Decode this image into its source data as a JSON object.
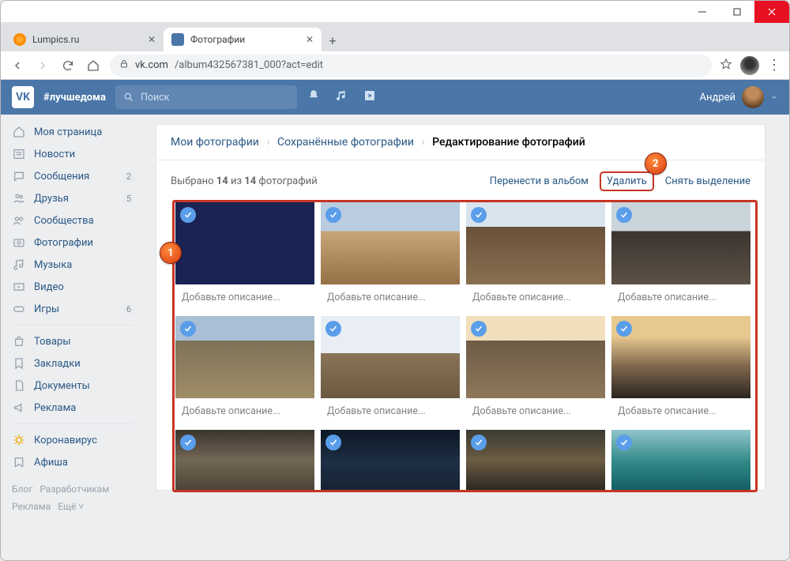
{
  "window": {
    "tabs": [
      {
        "title": "Lumpics.ru",
        "active": false
      },
      {
        "title": "Фотографии",
        "active": true
      }
    ]
  },
  "browser": {
    "url_host": "vk.com",
    "url_path": "/album432567381_000?act=edit"
  },
  "vk": {
    "logo_text": "VK",
    "hashtag": "#лучшедома",
    "search_placeholder": "Поиск",
    "user_name": "Андрей"
  },
  "sidebar": {
    "items": [
      {
        "icon": "home",
        "label": "Моя страница"
      },
      {
        "icon": "news",
        "label": "Новости"
      },
      {
        "icon": "messages",
        "label": "Сообщения",
        "badge": "2"
      },
      {
        "icon": "friends",
        "label": "Друзья",
        "badge": "5"
      },
      {
        "icon": "groups",
        "label": "Сообщества"
      },
      {
        "icon": "photos",
        "label": "Фотографии"
      },
      {
        "icon": "music",
        "label": "Музыка"
      },
      {
        "icon": "video",
        "label": "Видео"
      },
      {
        "icon": "games",
        "label": "Игры",
        "badge": "6"
      }
    ],
    "items2": [
      {
        "icon": "market",
        "label": "Товары"
      },
      {
        "icon": "bookmark",
        "label": "Закладки"
      },
      {
        "icon": "docs",
        "label": "Документы"
      },
      {
        "icon": "ads",
        "label": "Реклама"
      }
    ],
    "items3": [
      {
        "icon": "covid",
        "label": "Коронавирус"
      },
      {
        "icon": "afisha",
        "label": "Афиша"
      }
    ],
    "footer": {
      "l1a": "Блог",
      "l1b": "Разработчикам",
      "l2a": "Реклама",
      "l2b": "Ещё ˅"
    }
  },
  "breadcrumbs": {
    "root": "Мои фотографии",
    "album": "Сохранённые фотографии",
    "current": "Редактирование фотографий"
  },
  "selection_bar": {
    "text_pre": "Выбрано ",
    "sel": "14",
    "text_mid": " из ",
    "total": "14",
    "text_post": " фотографий",
    "move": "Перенести в альбом",
    "delete": "Удалить",
    "deselect": "Снять выделение"
  },
  "photos": {
    "placeholder": "Добавьте описание...",
    "count": 12
  },
  "badges": {
    "one": "1",
    "two": "2"
  }
}
